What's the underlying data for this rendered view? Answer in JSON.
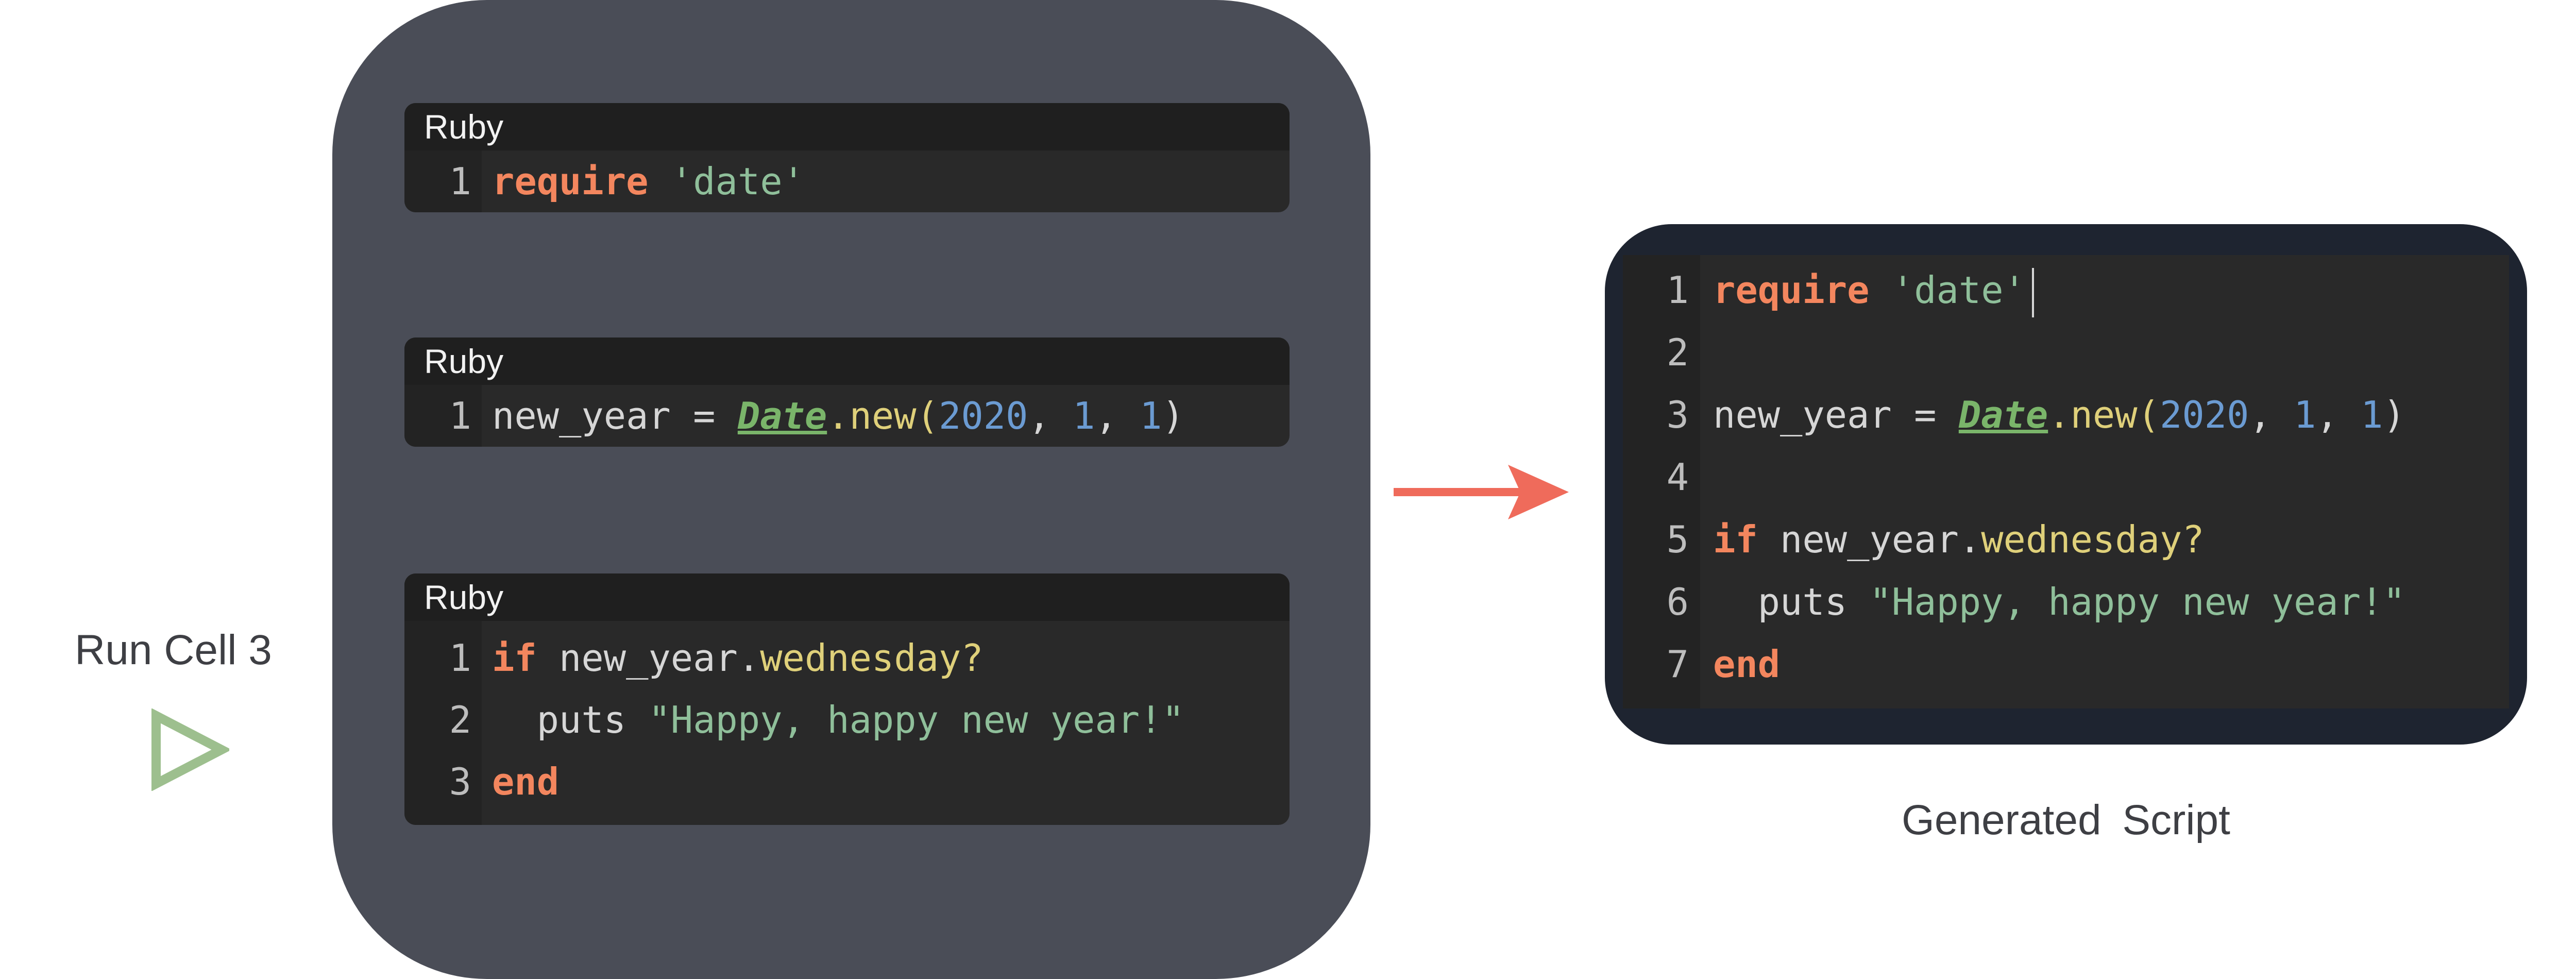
{
  "notebook": {
    "cells": [
      {
        "language": "Ruby",
        "lines": [
          {
            "num": "1",
            "tokens": [
              {
                "t": "require",
                "c": "kw"
              },
              {
                "t": " ",
                "c": "plain"
              },
              {
                "t": "'date'",
                "c": "str"
              }
            ]
          }
        ]
      },
      {
        "language": "Ruby",
        "lines": [
          {
            "num": "1",
            "tokens": [
              {
                "t": "new_year = ",
                "c": "plain"
              },
              {
                "t": "Date",
                "c": "cls"
              },
              {
                "t": ".new(",
                "c": "meth"
              },
              {
                "t": "2020",
                "c": "num"
              },
              {
                "t": ", ",
                "c": "plain"
              },
              {
                "t": "1",
                "c": "num"
              },
              {
                "t": ", ",
                "c": "plain"
              },
              {
                "t": "1",
                "c": "num"
              },
              {
                "t": ")",
                "c": "plain"
              }
            ]
          }
        ]
      },
      {
        "language": "Ruby",
        "lines": [
          {
            "num": "1",
            "tokens": [
              {
                "t": "if",
                "c": "kw"
              },
              {
                "t": " new_year.",
                "c": "plain"
              },
              {
                "t": "wednesday?",
                "c": "meth"
              }
            ]
          },
          {
            "num": "2",
            "tokens": [
              {
                "t": "  puts ",
                "c": "plain"
              },
              {
                "t": "\"Happy, happy new year!\"",
                "c": "str"
              }
            ]
          },
          {
            "num": "3",
            "tokens": [
              {
                "t": "end",
                "c": "kw"
              }
            ]
          }
        ]
      }
    ]
  },
  "run": {
    "label": "Run Cell 3",
    "icon": "play-icon"
  },
  "arrow": {
    "icon": "right-arrow-icon",
    "color": "#ef6b5b"
  },
  "script": {
    "label": "Generated  Script",
    "lines": [
      {
        "num": "1",
        "tokens": [
          {
            "t": "require",
            "c": "kw"
          },
          {
            "t": " ",
            "c": "plain"
          },
          {
            "t": "'date'",
            "c": "str"
          }
        ],
        "caret": true
      },
      {
        "num": "2",
        "tokens": []
      },
      {
        "num": "3",
        "tokens": [
          {
            "t": "new_year = ",
            "c": "plain"
          },
          {
            "t": "Date",
            "c": "cls"
          },
          {
            "t": ".new(",
            "c": "meth"
          },
          {
            "t": "2020",
            "c": "num"
          },
          {
            "t": ", ",
            "c": "plain"
          },
          {
            "t": "1",
            "c": "num"
          },
          {
            "t": ", ",
            "c": "plain"
          },
          {
            "t": "1",
            "c": "num"
          },
          {
            "t": ")",
            "c": "plain"
          }
        ]
      },
      {
        "num": "4",
        "tokens": []
      },
      {
        "num": "5",
        "tokens": [
          {
            "t": "if",
            "c": "kw"
          },
          {
            "t": " new_year.",
            "c": "plain"
          },
          {
            "t": "wednesday?",
            "c": "meth"
          }
        ]
      },
      {
        "num": "6",
        "tokens": [
          {
            "t": "  puts ",
            "c": "plain"
          },
          {
            "t": "\"Happy, happy new year!\"",
            "c": "str"
          }
        ]
      },
      {
        "num": "7",
        "tokens": [
          {
            "t": "end",
            "c": "kw"
          }
        ]
      }
    ]
  },
  "colors": {
    "notebook_bg": "#4a4d57",
    "script_frame": "#1e2430",
    "editor_bg": "#292929",
    "keyword": "#f3865e",
    "string": "#8fbf9a",
    "number": "#6b9bd2",
    "method": "#dfd07a",
    "class": "#7ab56a",
    "play_icon": "#9dbf8e"
  }
}
